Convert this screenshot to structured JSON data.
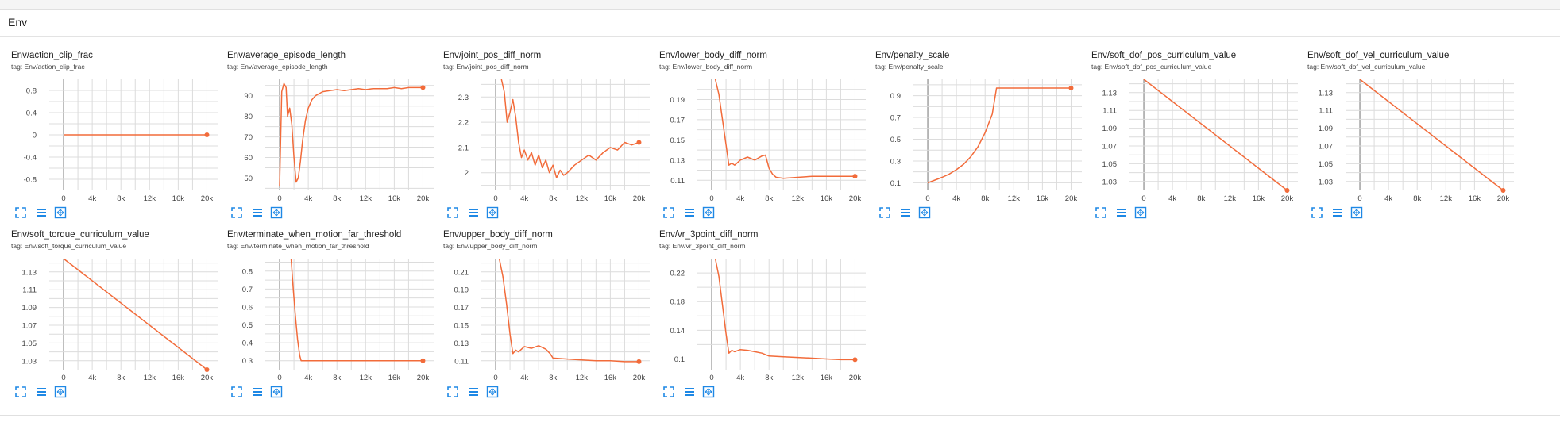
{
  "group": {
    "title": "Env"
  },
  "icons": {
    "expand": "fullscreen-icon",
    "data": "data-table-icon",
    "fit": "fit-domain-icon",
    "accent": "#1e88e5"
  },
  "series_color": "#f26b3a",
  "chart_data": [
    {
      "type": "line",
      "title": "Env/action_clip_frac",
      "tag": "tag: Env/action_clip_frac",
      "xlim": [
        -2000,
        21500
      ],
      "ylim": [
        -1.0,
        1.0
      ],
      "xticks": [
        0,
        4000,
        8000,
        12000,
        16000,
        20000
      ],
      "xtick_labels": [
        "0",
        "4k",
        "8k",
        "12k",
        "16k",
        "20k"
      ],
      "yticks": [
        -0.8,
        -0.4,
        0,
        0.4,
        0.8
      ],
      "ytick_labels": [
        "-0.8",
        "-0.4",
        "0",
        "0.4",
        "0.8"
      ],
      "x": [
        0,
        20000
      ],
      "y": [
        0,
        0
      ]
    },
    {
      "type": "line",
      "title": "Env/average_episode_length",
      "tag": "tag: Env/average_episode_length",
      "xlim": [
        -2000,
        21500
      ],
      "ylim": [
        44,
        98
      ],
      "xticks": [
        0,
        4000,
        8000,
        12000,
        16000,
        20000
      ],
      "xtick_labels": [
        "0",
        "4k",
        "8k",
        "12k",
        "16k",
        "20k"
      ],
      "yticks": [
        50,
        60,
        70,
        80,
        90
      ],
      "ytick_labels": [
        "50",
        "60",
        "70",
        "80",
        "90"
      ],
      "x": [
        0,
        300,
        600,
        900,
        1100,
        1400,
        1700,
        2000,
        2300,
        2600,
        2900,
        3200,
        3600,
        4000,
        4500,
        5000,
        5500,
        6000,
        7000,
        8000,
        9000,
        10000,
        11000,
        12000,
        13000,
        14000,
        15000,
        16000,
        17000,
        18000,
        19000,
        20000
      ],
      "y": [
        46,
        92,
        96,
        94,
        80,
        84,
        76,
        60,
        48,
        50,
        58,
        68,
        78,
        84,
        88,
        90,
        91,
        92,
        92.5,
        93,
        92.5,
        93,
        93.5,
        93,
        93.5,
        93.5,
        93.5,
        94,
        93.5,
        94,
        94,
        94
      ]
    },
    {
      "type": "line",
      "title": "Env/joint_pos_diff_norm",
      "tag": "tag: Env/joint_pos_diff_norm",
      "xlim": [
        -2000,
        21500
      ],
      "ylim": [
        1.93,
        2.37
      ],
      "xticks": [
        0,
        4000,
        8000,
        12000,
        16000,
        20000
      ],
      "xtick_labels": [
        "0",
        "4k",
        "8k",
        "12k",
        "16k",
        "20k"
      ],
      "yticks": [
        2.0,
        2.1,
        2.2,
        2.3
      ],
      "ytick_labels": [
        "2",
        "2.1",
        "2.2",
        "2.3"
      ],
      "x": [
        800,
        1200,
        1600,
        2000,
        2400,
        2800,
        3200,
        3600,
        4000,
        4500,
        5000,
        5500,
        6000,
        6500,
        7000,
        7500,
        8000,
        8500,
        9000,
        9500,
        10000,
        11000,
        12000,
        13000,
        14000,
        15000,
        16000,
        17000,
        18000,
        19000,
        20000
      ],
      "y": [
        2.37,
        2.32,
        2.2,
        2.24,
        2.29,
        2.22,
        2.12,
        2.06,
        2.09,
        2.05,
        2.08,
        2.03,
        2.07,
        2.02,
        2.05,
        2.0,
        2.03,
        1.98,
        2.01,
        1.99,
        2.0,
        2.03,
        2.05,
        2.07,
        2.05,
        2.08,
        2.1,
        2.09,
        2.12,
        2.11,
        2.12
      ]
    },
    {
      "type": "line",
      "title": "Env/lower_body_diff_norm",
      "tag": "tag: Env/lower_body_diff_norm",
      "xlim": [
        -2000,
        21500
      ],
      "ylim": [
        0.1,
        0.21
      ],
      "xticks": [
        0,
        4000,
        8000,
        12000,
        16000,
        20000
      ],
      "xtick_labels": [
        "0",
        "4k",
        "8k",
        "12k",
        "16k",
        "20k"
      ],
      "yticks": [
        0.11,
        0.13,
        0.15,
        0.17,
        0.19
      ],
      "ytick_labels": [
        "0.11",
        "0.13",
        "0.15",
        "0.17",
        "0.19"
      ],
      "x": [
        500,
        1000,
        1500,
        2000,
        2400,
        2800,
        3200,
        4000,
        5000,
        6000,
        7000,
        7500,
        8000,
        8500,
        9000,
        10000,
        12000,
        14000,
        16000,
        18000,
        20000
      ],
      "y": [
        0.21,
        0.195,
        0.17,
        0.145,
        0.125,
        0.127,
        0.125,
        0.13,
        0.133,
        0.13,
        0.134,
        0.135,
        0.122,
        0.116,
        0.113,
        0.112,
        0.113,
        0.114,
        0.114,
        0.114,
        0.114
      ]
    },
    {
      "type": "line",
      "title": "Env/penalty_scale",
      "tag": "tag: Env/penalty_scale",
      "xlim": [
        -2000,
        21500
      ],
      "ylim": [
        0.03,
        1.05
      ],
      "xticks": [
        0,
        4000,
        8000,
        12000,
        16000,
        20000
      ],
      "xtick_labels": [
        "0",
        "4k",
        "8k",
        "12k",
        "16k",
        "20k"
      ],
      "yticks": [
        0.1,
        0.3,
        0.5,
        0.7,
        0.9
      ],
      "ytick_labels": [
        "0.1",
        "0.3",
        "0.5",
        "0.7",
        "0.9"
      ],
      "x": [
        0,
        1000,
        2000,
        3000,
        4000,
        5000,
        6000,
        7000,
        8000,
        9000,
        9600,
        10000,
        12000,
        14000,
        16000,
        18000,
        20000
      ],
      "y": [
        0.1,
        0.125,
        0.15,
        0.18,
        0.22,
        0.27,
        0.34,
        0.43,
        0.56,
        0.73,
        0.97,
        0.97,
        0.97,
        0.97,
        0.97,
        0.97,
        0.97
      ]
    },
    {
      "type": "line",
      "title": "Env/soft_dof_pos_curriculum_value",
      "tag": "tag: Env/soft_dof_pos_curriculum_value",
      "xlim": [
        -2000,
        21500
      ],
      "ylim": [
        1.02,
        1.145
      ],
      "xticks": [
        0,
        4000,
        8000,
        12000,
        16000,
        20000
      ],
      "xtick_labels": [
        "0",
        "4k",
        "8k",
        "12k",
        "16k",
        "20k"
      ],
      "yticks": [
        1.03,
        1.05,
        1.07,
        1.09,
        1.11,
        1.13
      ],
      "ytick_labels": [
        "1.03",
        "1.05",
        "1.07",
        "1.09",
        "1.11",
        "1.13"
      ],
      "x": [
        0,
        20000
      ],
      "y": [
        1.145,
        1.02
      ]
    },
    {
      "type": "line",
      "title": "Env/soft_dof_vel_curriculum_value",
      "tag": "tag: Env/soft_dof_vel_curriculum_value",
      "xlim": [
        -2000,
        21500
      ],
      "ylim": [
        1.02,
        1.145
      ],
      "xticks": [
        0,
        4000,
        8000,
        12000,
        16000,
        20000
      ],
      "xtick_labels": [
        "0",
        "4k",
        "8k",
        "12k",
        "16k",
        "20k"
      ],
      "yticks": [
        1.03,
        1.05,
        1.07,
        1.09,
        1.11,
        1.13
      ],
      "ytick_labels": [
        "1.03",
        "1.05",
        "1.07",
        "1.09",
        "1.11",
        "1.13"
      ],
      "x": [
        0,
        20000
      ],
      "y": [
        1.145,
        1.02
      ]
    },
    {
      "type": "line",
      "title": "Env/soft_torque_curriculum_value",
      "tag": "tag: Env/soft_torque_curriculum_value",
      "xlim": [
        -2000,
        21500
      ],
      "ylim": [
        1.02,
        1.145
      ],
      "xticks": [
        0,
        4000,
        8000,
        12000,
        16000,
        20000
      ],
      "xtick_labels": [
        "0",
        "4k",
        "8k",
        "12k",
        "16k",
        "20k"
      ],
      "yticks": [
        1.03,
        1.05,
        1.07,
        1.09,
        1.11,
        1.13
      ],
      "ytick_labels": [
        "1.03",
        "1.05",
        "1.07",
        "1.09",
        "1.11",
        "1.13"
      ],
      "x": [
        0,
        20000
      ],
      "y": [
        1.145,
        1.02
      ]
    },
    {
      "type": "line",
      "title": "Env/terminate_when_motion_far_threshold",
      "tag": "tag: Env/terminate_when_motion_far_threshold",
      "xlim": [
        -2000,
        21500
      ],
      "ylim": [
        0.25,
        0.87
      ],
      "xticks": [
        0,
        4000,
        8000,
        12000,
        16000,
        20000
      ],
      "xtick_labels": [
        "0",
        "4k",
        "8k",
        "12k",
        "16k",
        "20k"
      ],
      "yticks": [
        0.3,
        0.4,
        0.5,
        0.6,
        0.7,
        0.8
      ],
      "ytick_labels": [
        "0.3",
        "0.4",
        "0.5",
        "0.6",
        "0.7",
        "0.8"
      ],
      "x": [
        1600,
        1900,
        2200,
        2500,
        2800,
        3000,
        6000,
        10000,
        14000,
        18000,
        20000
      ],
      "y": [
        0.87,
        0.7,
        0.55,
        0.42,
        0.33,
        0.3,
        0.3,
        0.3,
        0.3,
        0.3,
        0.3
      ]
    },
    {
      "type": "line",
      "title": "Env/upper_body_diff_norm",
      "tag": "tag: Env/upper_body_diff_norm",
      "xlim": [
        -2000,
        21500
      ],
      "ylim": [
        0.1,
        0.225
      ],
      "xticks": [
        0,
        4000,
        8000,
        12000,
        16000,
        20000
      ],
      "xtick_labels": [
        "0",
        "4k",
        "8k",
        "12k",
        "16k",
        "20k"
      ],
      "yticks": [
        0.11,
        0.13,
        0.15,
        0.17,
        0.19,
        0.21
      ],
      "ytick_labels": [
        "0.11",
        "0.13",
        "0.15",
        "0.17",
        "0.19",
        "0.21"
      ],
      "x": [
        500,
        1000,
        1500,
        2000,
        2400,
        2800,
        3200,
        4000,
        5000,
        6000,
        7000,
        7600,
        8000,
        10000,
        12000,
        14000,
        16000,
        18000,
        20000
      ],
      "y": [
        0.225,
        0.205,
        0.175,
        0.14,
        0.118,
        0.122,
        0.12,
        0.126,
        0.124,
        0.127,
        0.123,
        0.118,
        0.113,
        0.112,
        0.111,
        0.11,
        0.11,
        0.109,
        0.109
      ]
    },
    {
      "type": "line",
      "title": "Env/vr_3point_diff_norm",
      "tag": "tag: Env/vr_3point_diff_norm",
      "xlim": [
        -2000,
        21500
      ],
      "ylim": [
        0.085,
        0.24
      ],
      "xticks": [
        0,
        4000,
        8000,
        12000,
        16000,
        20000
      ],
      "xtick_labels": [
        "0",
        "4k",
        "8k",
        "12k",
        "16k",
        "20k"
      ],
      "yticks": [
        0.1,
        0.14,
        0.18,
        0.22
      ],
      "ytick_labels": [
        "0.1",
        "0.14",
        "0.18",
        "0.22"
      ],
      "x": [
        500,
        1000,
        1500,
        2000,
        2400,
        2800,
        3200,
        4000,
        5000,
        6000,
        7000,
        8000,
        10000,
        12000,
        14000,
        16000,
        18000,
        20000
      ],
      "y": [
        0.24,
        0.215,
        0.175,
        0.135,
        0.108,
        0.112,
        0.11,
        0.113,
        0.112,
        0.11,
        0.108,
        0.104,
        0.103,
        0.102,
        0.101,
        0.1,
        0.099,
        0.099
      ]
    }
  ]
}
